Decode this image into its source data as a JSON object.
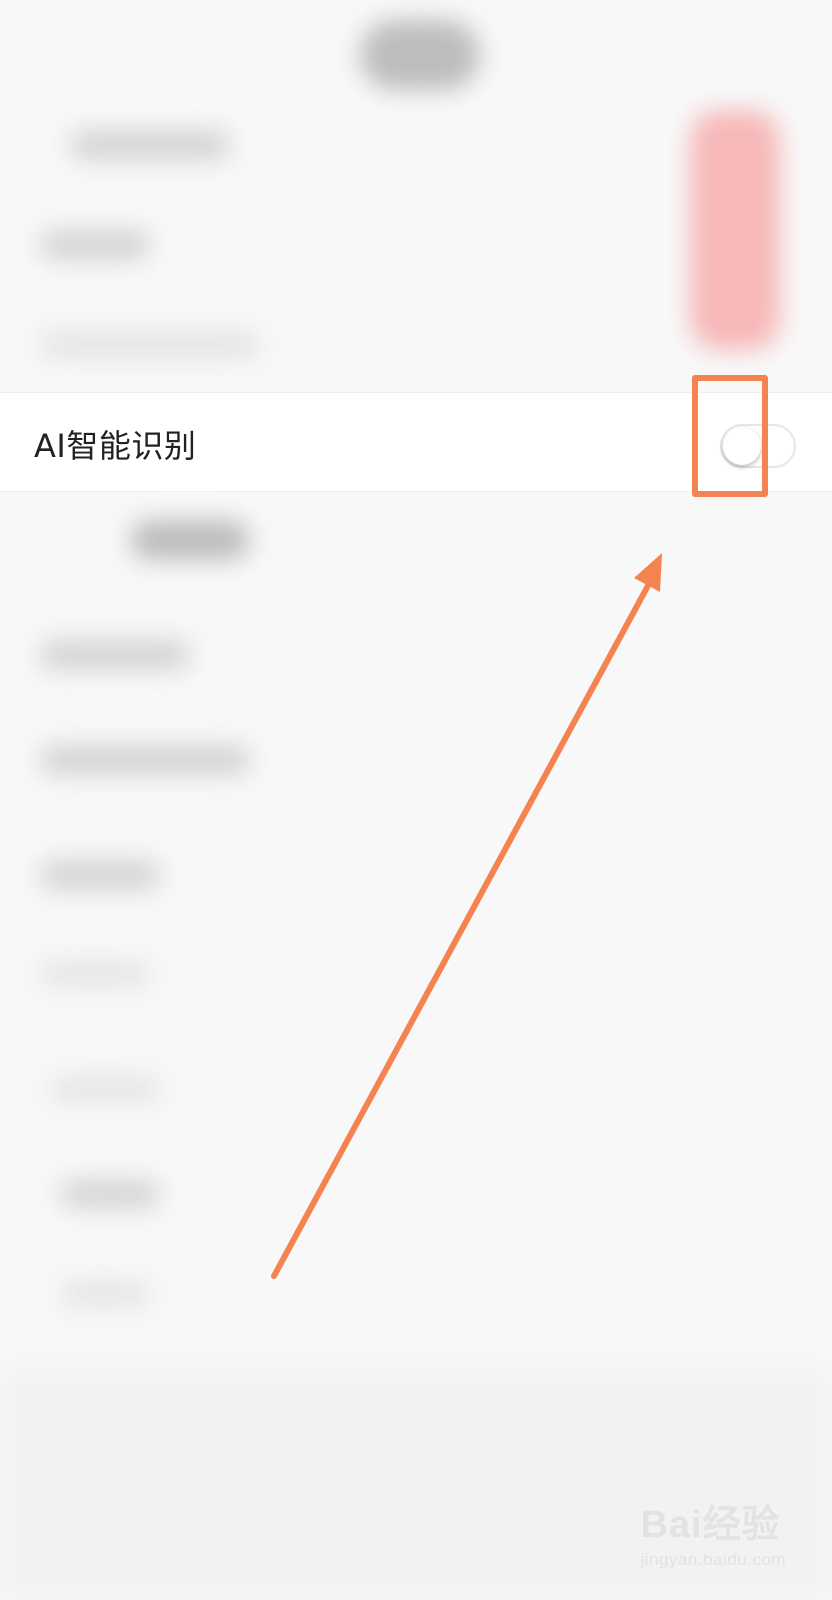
{
  "setting": {
    "label": "AI智能识别",
    "toggle_state": "off"
  },
  "annotation": {
    "color": "#f5834f"
  },
  "watermark": {
    "main_text": "Bai经验",
    "url_text": "jingyan.baidu.com"
  }
}
